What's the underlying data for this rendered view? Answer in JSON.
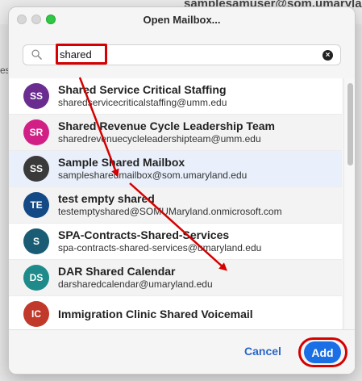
{
  "background": {
    "user_label": "samplesamuser@som.umaryland",
    "left_fragment": "es"
  },
  "window": {
    "title": "Open Mailbox..."
  },
  "search": {
    "value": "shared",
    "icon": "search-icon",
    "clear_icon": "clear-icon"
  },
  "mailboxes": [
    {
      "initials": "SS",
      "name": "Shared Service Critical Staffing",
      "email": "sharedservicecriticalstaffing@umm.edu",
      "color": "#6a2d8f"
    },
    {
      "initials": "SR",
      "name": "Shared Revenue Cycle Leadership Team",
      "email": "sharedrevenuecycleleadershipteam@umm.edu",
      "color": "#d11f86"
    },
    {
      "initials": "SS",
      "name": "Sample Shared Mailbox",
      "email": "samplesharedmailbox@som.umaryland.edu",
      "color": "#3a3a3a"
    },
    {
      "initials": "TE",
      "name": "test empty shared",
      "email": "testemptyshared@SOMUMaryland.onmicrosoft.com",
      "color": "#134a86"
    },
    {
      "initials": "S",
      "name": "SPA-Contracts-Shared-Services",
      "email": "spa-contracts-shared-services@umaryland.edu",
      "color": "#1a5c74"
    },
    {
      "initials": "DS",
      "name": "DAR Shared Calendar",
      "email": "darsharedcalendar@umaryland.edu",
      "color": "#1f8a8a"
    },
    {
      "initials": "IC",
      "name": "Immigration Clinic Shared Voicemail",
      "email": "",
      "color": "#c0392b"
    }
  ],
  "footer": {
    "cancel_label": "Cancel",
    "add_label": "Add"
  },
  "colors": {
    "accent": "#1a6fe6",
    "annotation": "#d50000"
  }
}
